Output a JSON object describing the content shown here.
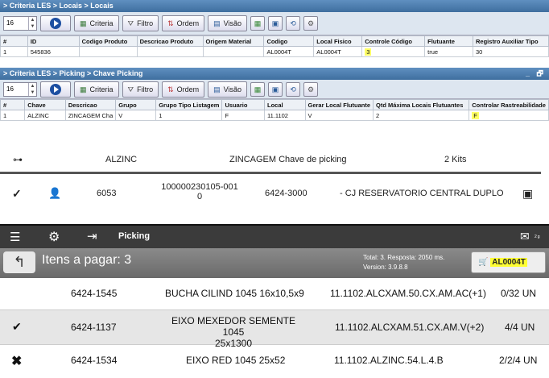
{
  "window1": {
    "title": "> Criteria LES > Locais > Locais",
    "spin_value": "16",
    "buttons": {
      "criteria": "Criteria",
      "filtro": "Filtro",
      "ordem": "Ordem",
      "visao": "Visão"
    },
    "columns": [
      "#",
      "ID",
      "Codigo Produto",
      "Descricao Produto",
      "Origem Material",
      "Codigo",
      "Local Fisico",
      "Controle Código",
      "Flutuante",
      "Registro Auxiliar Tipo"
    ],
    "row": [
      "1",
      "545836",
      "",
      "",
      "",
      "AL0004T",
      "AL0004T",
      "3",
      "true",
      "30"
    ]
  },
  "window2": {
    "title": "> Criteria LES > Picking > Chave Picking",
    "controls": "_ 🗗",
    "spin_value": "16",
    "buttons": {
      "criteria": "Criteria",
      "filtro": "Filtro",
      "ordem": "Ordem",
      "visao": "Visão"
    },
    "columns": [
      "#",
      "Chave",
      "Descricao",
      "Grupo",
      "Grupo Tipo Listagem",
      "Usuario",
      "Local",
      "Gerar Local Flutuante",
      "Qtd Máxima Locais Flutuantes",
      "Controlar Rastreabilidade"
    ],
    "row": [
      "1",
      "ALZINC",
      "ZINCAGEM Cha",
      "V",
      "1",
      "F",
      "11.1102",
      "V",
      "2",
      "F"
    ]
  },
  "key_row": {
    "key": "ALZINC",
    "description": "ZINCAGEM Chave de picking",
    "qty": "2 Kits"
  },
  "order_row": {
    "num": "6053",
    "code_line1": "100000230105-001",
    "code_line2": "0",
    "product": "6424-3000",
    "description": "- CJ RESERVATORIO CENTRAL DUPLO"
  },
  "app": {
    "title": "Picking",
    "badge": "2 g",
    "items_label": "Itens a pagar: 3",
    "total": "Total: 3. Resposta: 2050 ms.",
    "version": "Version: 3.9.8.8",
    "cart_location": "AL0004T"
  },
  "picks": [
    {
      "code": "6424-1545",
      "desc1": "BUCHA CILIND 1045 16x10,5x9",
      "desc2": "",
      "loc": "11.1102.ALCXAM.50.CX.AM.AC(+1)",
      "qty": "0/32 UN"
    },
    {
      "code": "6424-1137",
      "desc1": "EIXO MEXEDOR SEMENTE 1045",
      "desc2": "25x1300",
      "loc": "11.1102.ALCXAM.51.CX.AM.V(+2)",
      "qty": "4/4 UN"
    },
    {
      "code": "6424-1534",
      "desc1": "EIXO RED 1045 25x52",
      "desc2": "",
      "loc": "11.1102.ALZINC.54.L.4.B",
      "qty": "2/2/4 UN"
    }
  ],
  "colors": {
    "highlight": "#ffff66",
    "titlebar": "#4f7fb0"
  }
}
